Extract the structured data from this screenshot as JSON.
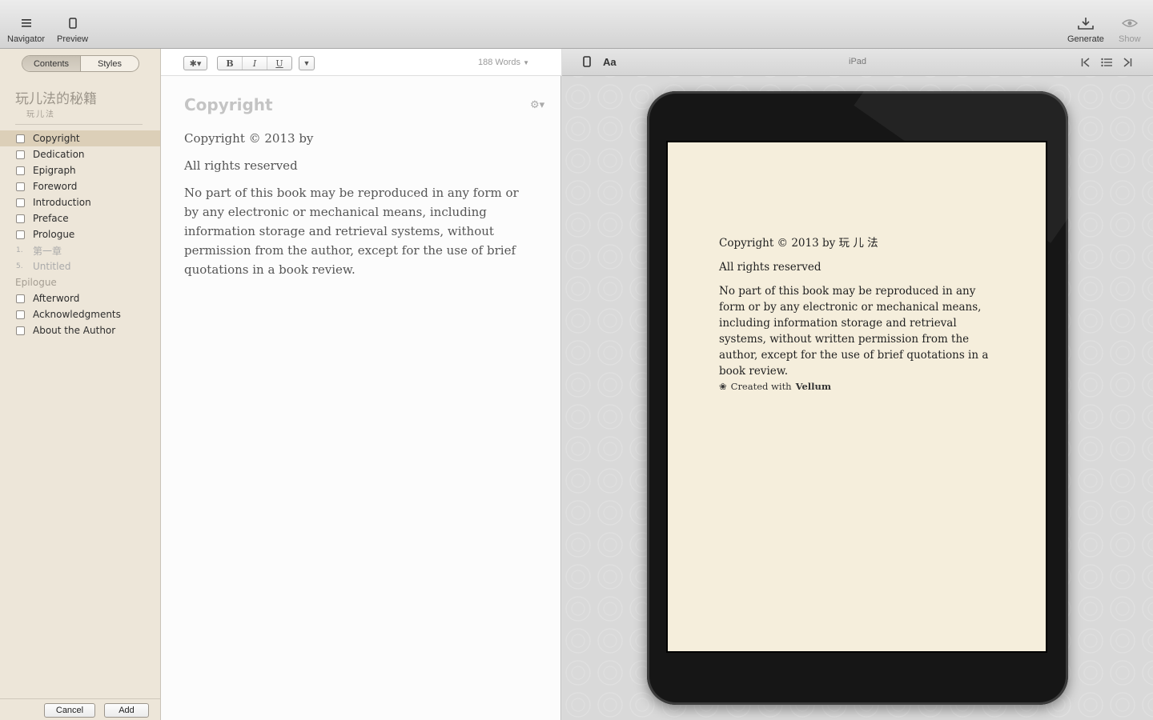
{
  "toolbar": {
    "navigator": "Navigator",
    "preview": "Preview",
    "generate": "Generate",
    "show": "Show"
  },
  "sidebar": {
    "tabs": [
      {
        "label": "Contents",
        "active": true
      },
      {
        "label": "Styles",
        "active": false
      }
    ],
    "book_title": "玩儿法的秘籍",
    "book_author": "玩儿法",
    "items": [
      {
        "label": "Copyright",
        "kind": "checkbox",
        "selected": true
      },
      {
        "label": "Dedication",
        "kind": "checkbox"
      },
      {
        "label": "Epigraph",
        "kind": "checkbox"
      },
      {
        "label": "Foreword",
        "kind": "checkbox"
      },
      {
        "label": "Introduction",
        "kind": "checkbox"
      },
      {
        "label": "Preface",
        "kind": "checkbox"
      },
      {
        "label": "Prologue",
        "kind": "checkbox"
      },
      {
        "label": "第一章",
        "kind": "numbered",
        "num": "1."
      },
      {
        "label": "Untitled",
        "kind": "numbered",
        "num": "5."
      },
      {
        "label": "Epilogue",
        "kind": "section"
      },
      {
        "label": "Afterword",
        "kind": "checkbox"
      },
      {
        "label": "Acknowledgments",
        "kind": "checkbox"
      },
      {
        "label": "About the Author",
        "kind": "checkbox"
      }
    ],
    "cancel": "Cancel",
    "add": "Add"
  },
  "editor": {
    "format": {
      "bold": "B",
      "italic": "I",
      "underline": "U"
    },
    "word_count": "188 Words",
    "title": "Copyright",
    "paragraphs": [
      "Copyright © 2013 by",
      "All rights reserved",
      "No part of this book may be reproduced in any form or by any electronic or mechanical means, including information storage and retrieval systems, without permission from the author, except for the use of brief quotations in a book review."
    ]
  },
  "preview": {
    "font_button": "Aa",
    "device": "iPad",
    "paragraphs": [
      "Copyright © 2013 by 玩 儿 法",
      "All rights reserved",
      "No part of this book may be reproduced in any form or by any electronic or mechanical means, including information storage and retrieval systems, without written permission from the author, except for the use of brief quotations in a book review."
    ],
    "created_with": "Created with",
    "brand": "Vellum"
  }
}
